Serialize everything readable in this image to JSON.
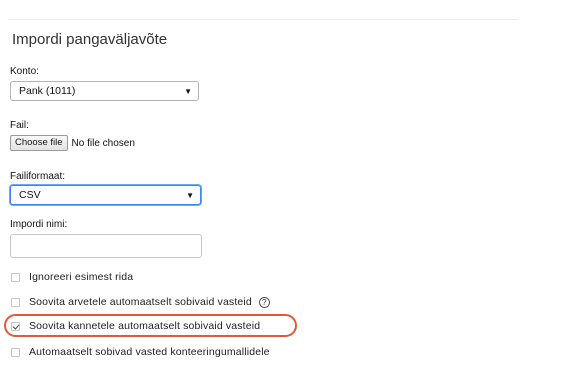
{
  "page": {
    "title": "Impordi pangaväljavõte"
  },
  "account": {
    "label": "Konto:",
    "selected": "Pank (1011)"
  },
  "file": {
    "label": "Fail:",
    "button": "Choose file",
    "status": "No file chosen"
  },
  "file_format": {
    "label": "Failiformaat:",
    "selected": "CSV"
  },
  "import_name": {
    "label": "Impordi nimi:",
    "value": ""
  },
  "options": [
    {
      "label": "Ignoreeri esimest rida",
      "checked": false
    },
    {
      "label": "Soovita arvetele automaatselt sobivaid vasteid",
      "checked": false,
      "help_icon": "question-circle-icon"
    },
    {
      "label": "Soovita kannetele automaatselt sobivaid vasteid",
      "checked": true,
      "highlighted": true
    },
    {
      "label": "Automaatselt sobivad vasted konteeringumallidele",
      "checked": false
    }
  ],
  "colors": {
    "highlight": "#e05b3d",
    "focus": "#3b83f7"
  },
  "icons": {
    "dropdown": "▼",
    "help": "?"
  }
}
